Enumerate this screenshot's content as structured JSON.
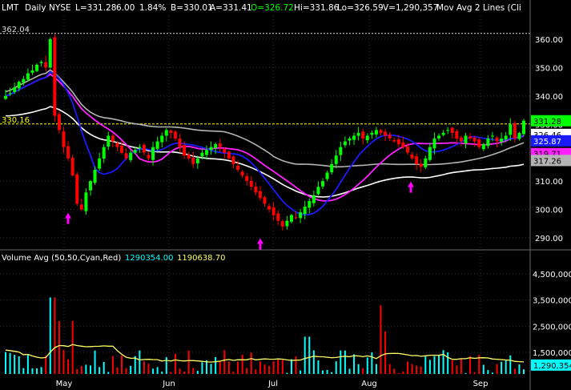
{
  "header": {
    "symbol": "LMT",
    "interval": "Daily",
    "exchange": "NYSE",
    "last": "L=331.28",
    "change": "6.00",
    "change_pct": "1.84%",
    "bid": "B=330.01",
    "ask": "A=331.41",
    "open": "O=326.72",
    "high": "Hi=331.86",
    "low": "Lo=326.59",
    "volume": "V=1,290,357",
    "study": "Mov Avg 2 Lines (Cli"
  },
  "volume_header": {
    "label": "Volume Avg (50,50,Cyan,Red)",
    "value1": "1290354.00",
    "value2": "1190638.70"
  },
  "price_labels": {
    "high_level": "362.04",
    "resistance_level": "330.16",
    "last_price": "331.28",
    "ma_white": "326.46",
    "ma_blue": "325.87",
    "ma_magenta": "319.71",
    "ma_gray": "317.26",
    "volume_last": "1,290,354"
  },
  "colors": {
    "background": "#000000",
    "up_candle": "#00ff00",
    "down_candle": "#ff0000",
    "ma_blue": "#1a1aff",
    "ma_magenta": "#ff20ff",
    "ma_white": "#ffffff",
    "ma_gray": "#b4b4b4",
    "volume_avg": "#ffff66",
    "resistance_line": "#ffff00",
    "arrows": "#ff00ff",
    "volume_up": "#00ffff",
    "volume_down": "#ff0000"
  },
  "chart_data": {
    "type": "candlestick",
    "ylim": [
      284,
      366
    ],
    "yticks": [
      290,
      300,
      310,
      320,
      330,
      340,
      350,
      360
    ],
    "xlabels": [
      "May",
      "Jun",
      "Jul",
      "Aug",
      "Sep"
    ],
    "volume_ylim": [
      0,
      4800000
    ],
    "volume_ticks": [
      "1,500,000",
      "2,500,000",
      "3,500,000",
      "4,500,000"
    ],
    "volume_tick_values": [
      1500000,
      2500000,
      3500000,
      4500000
    ],
    "reference_lines": [
      362.04,
      330.16
    ],
    "arrow_markers": [
      {
        "month": "May",
        "price": 300
      },
      {
        "month": "Jul",
        "price": 291
      },
      {
        "month": "Aug",
        "price": 311
      }
    ],
    "closes": [
      340,
      341,
      343,
      345,
      346,
      348,
      349,
      351,
      352,
      350,
      360,
      333,
      328,
      322,
      318,
      312,
      302,
      300,
      306,
      310,
      314,
      318,
      322,
      326,
      324,
      322,
      320,
      318,
      320,
      321,
      322,
      320,
      318,
      322,
      324,
      326,
      328,
      327,
      325,
      322,
      319,
      318,
      316,
      318,
      320,
      321,
      322,
      323,
      322,
      320,
      318,
      316,
      314,
      312,
      310,
      308,
      306,
      304,
      302,
      300,
      298,
      296,
      294,
      296,
      298,
      297,
      299,
      301,
      303,
      305,
      308,
      310,
      313,
      316,
      319,
      322,
      324,
      325,
      326,
      327,
      325,
      326,
      327,
      328,
      327,
      326,
      325,
      324,
      323,
      322,
      320,
      318,
      316,
      315,
      318,
      322,
      325,
      326,
      327,
      328,
      327,
      325,
      324,
      326,
      325,
      324,
      322,
      323,
      325,
      326,
      324,
      325,
      326,
      330,
      325,
      327,
      331.28
    ]
  }
}
